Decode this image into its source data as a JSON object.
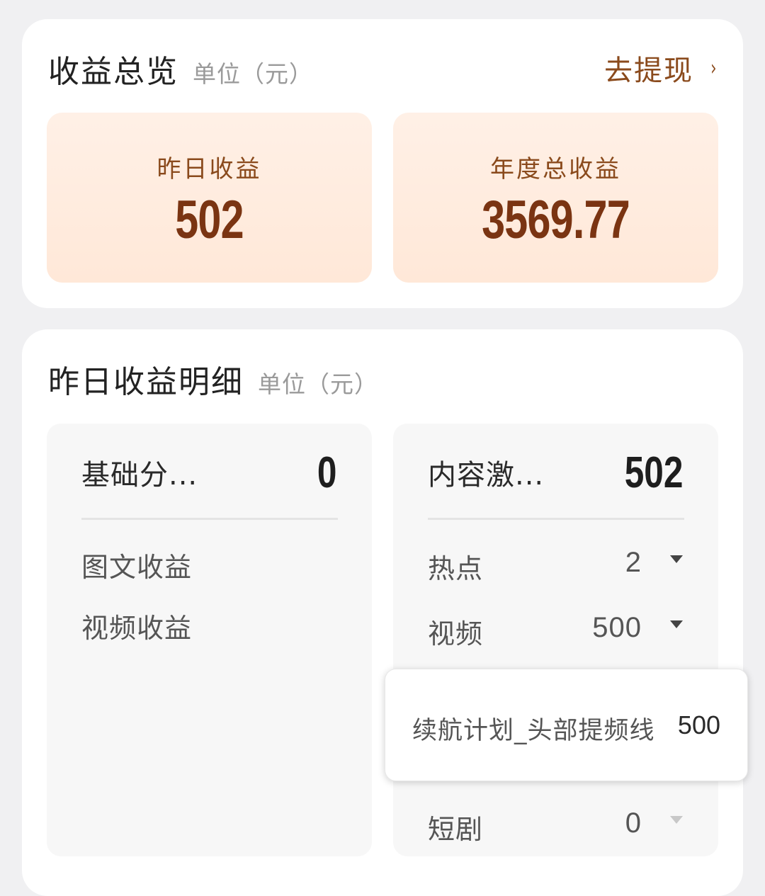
{
  "overview": {
    "title": "收益总览",
    "unit": "单位（元）",
    "withdraw_label": "去提现",
    "withdraw_chevron": "›",
    "yesterday": {
      "label": "昨日收益",
      "value": "502"
    },
    "annual": {
      "label": "年度总收益",
      "value": "3569.77"
    }
  },
  "detail": {
    "title": "昨日收益明细",
    "unit": "单位（元）",
    "basic": {
      "label": "基础分...",
      "value": "0",
      "items": [
        {
          "label": "图文收益"
        },
        {
          "label": "视频收益"
        }
      ]
    },
    "incentive": {
      "label": "内容激...",
      "value": "502",
      "items": [
        {
          "label": "热点",
          "value": "2"
        },
        {
          "label": "视频",
          "value": "500"
        },
        {
          "label": "短剧",
          "value": "0"
        }
      ]
    },
    "popup": {
      "label": "续航计划_头部提频线",
      "value": "500"
    }
  },
  "icons": {
    "expand": "caret-down-icon",
    "withdraw": "chevron-right-icon"
  },
  "colors": {
    "accent": "#8a4a1c",
    "value": "#7a3412",
    "stat_bg": "#ffeadc"
  }
}
